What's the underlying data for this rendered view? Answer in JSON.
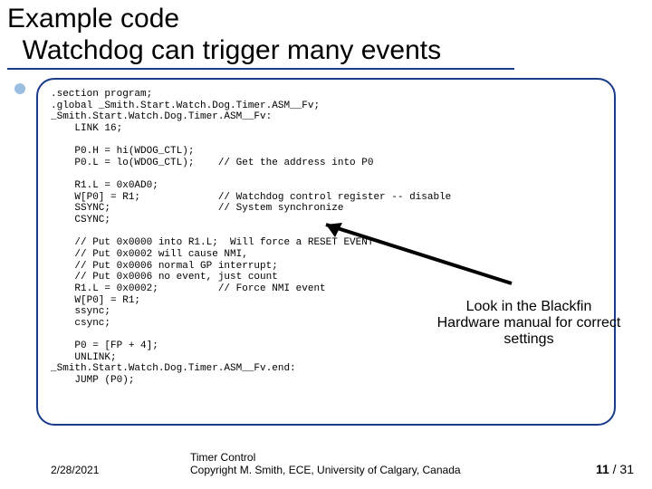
{
  "title": {
    "line1": "Example code",
    "line2": "Watchdog can trigger many events"
  },
  "code": {
    "l01": ".section program;",
    "l02": ".global _Smith.Start.Watch.Dog.Timer.ASM__Fv;",
    "l03": "_Smith.Start.Watch.Dog.Timer.ASM__Fv:",
    "l04": "    LINK 16;",
    "l05": "",
    "l06": "    P0.H = hi(WDOG_CTL);",
    "l07": "    P0.L = lo(WDOG_CTL);    // Get the address into P0",
    "l08": "",
    "l09": "    R1.L = 0x0AD0;",
    "l10": "    W[P0] = R1;             // Watchdog control register -- disable",
    "l11": "    SSYNC;                  // System synchronize",
    "l12": "    CSYNC;",
    "l13": "",
    "l14": "    // Put 0x0000 into R1.L;  Will force a RESET EVENT",
    "l15": "    // Put 0x0002 will cause NMI,",
    "l16": "    // Put 0x0006 normal GP interrupt;",
    "l17": "    // Put 0x0006 no event, just count",
    "l18": "    R1.L = 0x0002;          // Force NMI event",
    "l19": "    W[P0] = R1;",
    "l20": "    ssync;",
    "l21": "    csync;",
    "l22": "",
    "l23": "    P0 = [FP + 4];",
    "l24": "    UNLINK;",
    "l25": "_Smith.Start.Watch.Dog.Timer.ASM__Fv.end:",
    "l26": "    JUMP (P0);"
  },
  "annotation": {
    "line1": "Look in the Blackfin",
    "line2": "Hardware manual for correct settings"
  },
  "footer": {
    "date": "2/28/2021",
    "mid_line1": "Timer Control",
    "mid_line2": "Copyright M. Smith, ECE, University of Calgary, Canada",
    "page_current": "11",
    "page_sep": " / ",
    "page_total": "31"
  }
}
